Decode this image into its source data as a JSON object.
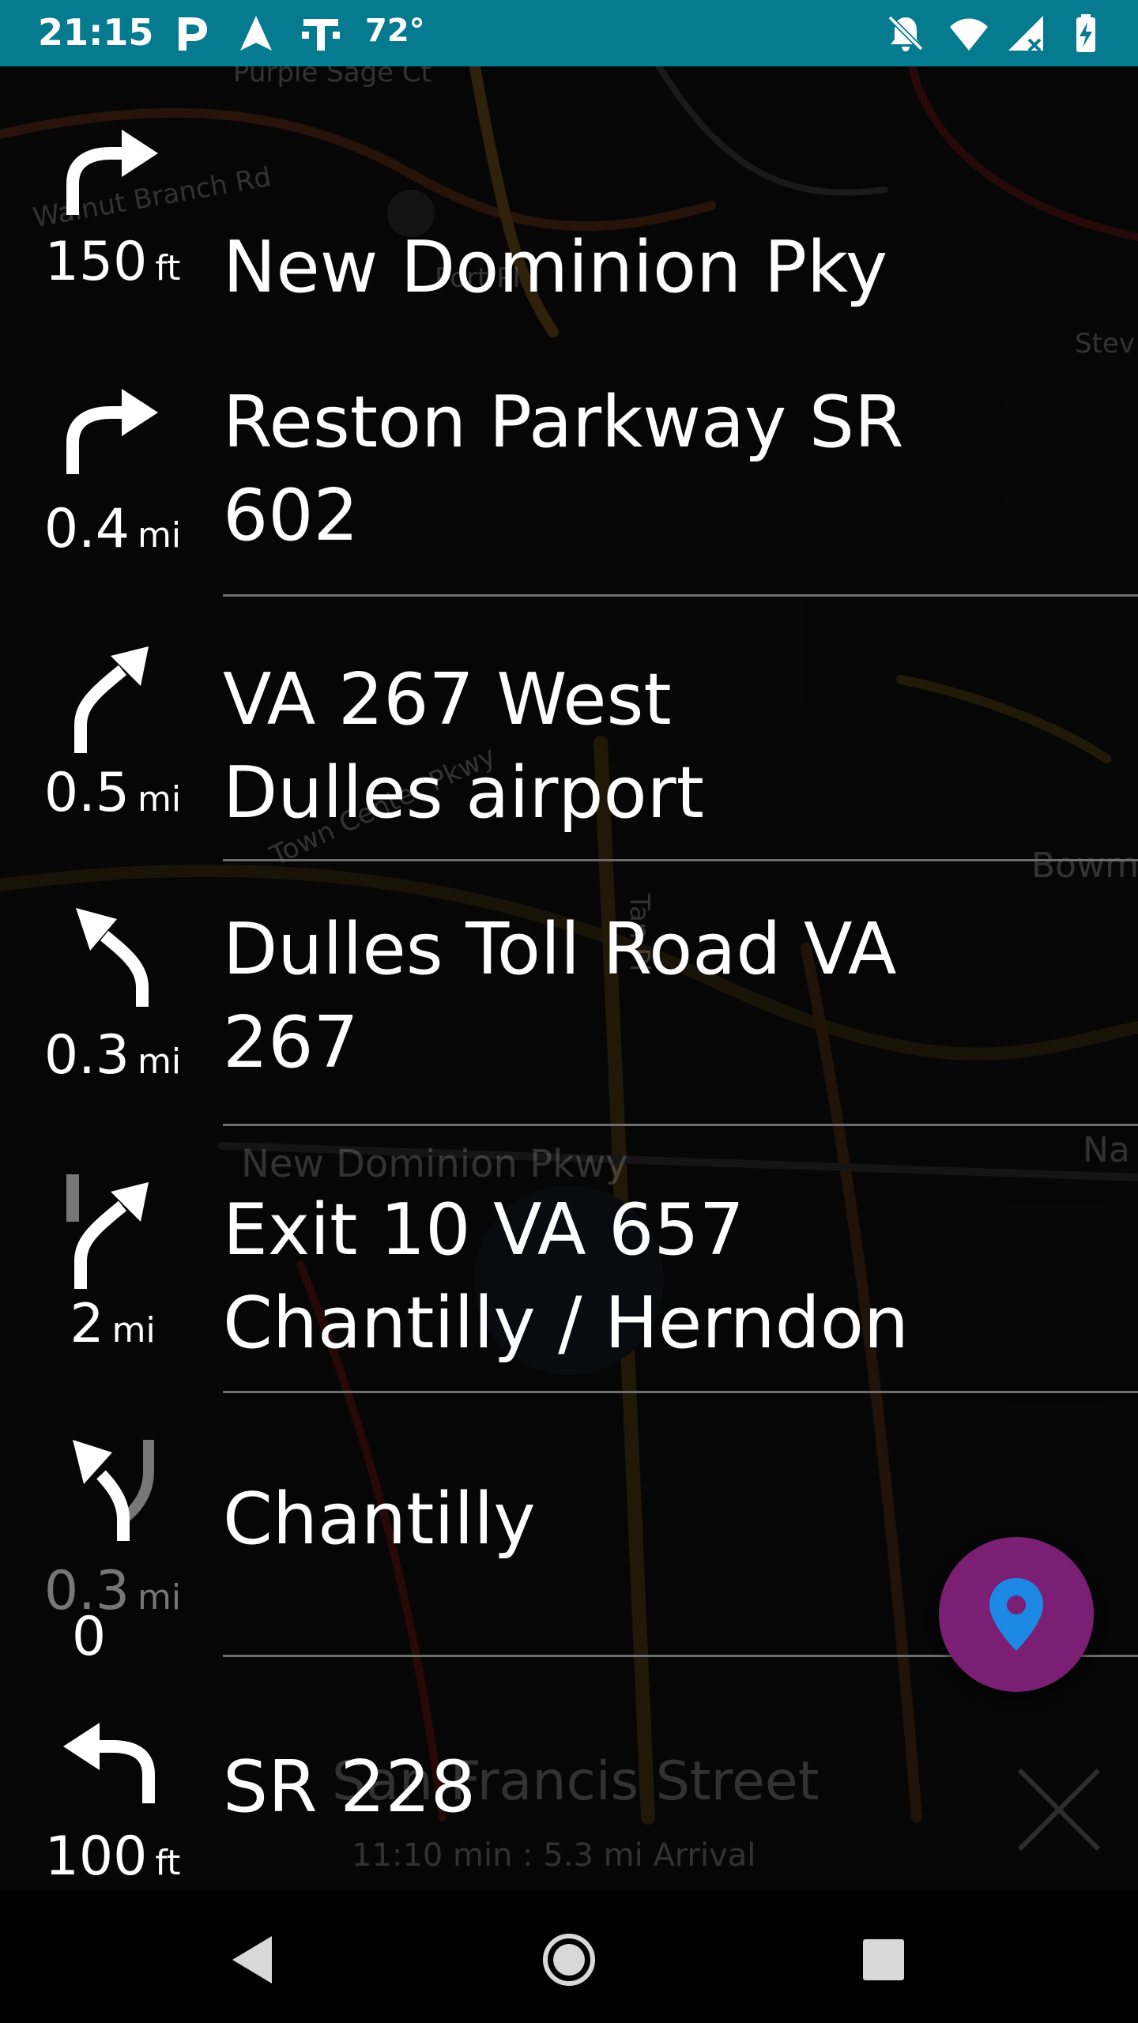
{
  "status_bar": {
    "time": "21:15",
    "temperature": "72°",
    "background": "#067b8f",
    "left_icons": [
      "parking-icon",
      "navigation-arrow-icon",
      "t-mobile-icon"
    ],
    "right_icons": [
      "notifications-off-icon",
      "wifi-icon",
      "cell-signal-icon",
      "battery-charging-icon"
    ]
  },
  "map_labels": {
    "street_1": "Purple Sage Ct",
    "street_2": "Walnut Branch Rd",
    "street_3": "Port Pl",
    "street_4": "Town Center Pkwy",
    "street_5": "New Dominion Pkwy",
    "street_6": "Tan Pl",
    "street_7": "Bowm",
    "street_8": "Stev",
    "street_9": "Na"
  },
  "route_summary": {
    "street": "San Francis Street",
    "eta": "11:10 min : 5.3 mi Arrival"
  },
  "directions": [
    {
      "icon": "turn-right-icon",
      "distance": "150",
      "unit": "ft",
      "line1": "New Dominion Pky",
      "line2": ""
    },
    {
      "icon": "turn-right-icon",
      "distance": "0.4",
      "unit": "mi",
      "line1": "Reston Parkway SR",
      "line2": "602"
    },
    {
      "icon": "slight-right-icon",
      "distance": "0.5",
      "unit": "mi",
      "line1": "VA 267 West",
      "line2": "Dulles airport"
    },
    {
      "icon": "slight-left-icon",
      "distance": "0.3",
      "unit": "mi",
      "line1": "Dulles Toll Road VA",
      "line2": "267"
    },
    {
      "icon": "exit-right-icon",
      "distance": "2",
      "unit": "mi",
      "line1": "Exit 10 VA 657",
      "line2": "Chantilly / Herndon"
    },
    {
      "icon": "fork-left-icon",
      "distance": "0.3",
      "unit": "mi",
      "line1": "Chantilly",
      "line2": "",
      "overlay_digit": "0"
    },
    {
      "icon": "turn-left-icon",
      "distance": "100",
      "unit": "ft",
      "line1": "SR 228",
      "line2": ""
    }
  ],
  "fab": {
    "icon": "location-pin-icon",
    "color": "#7a1f74",
    "pin_color": "#1e88e5"
  },
  "nav_bar": {
    "icons": [
      "back-icon",
      "home-icon",
      "recents-icon"
    ]
  }
}
